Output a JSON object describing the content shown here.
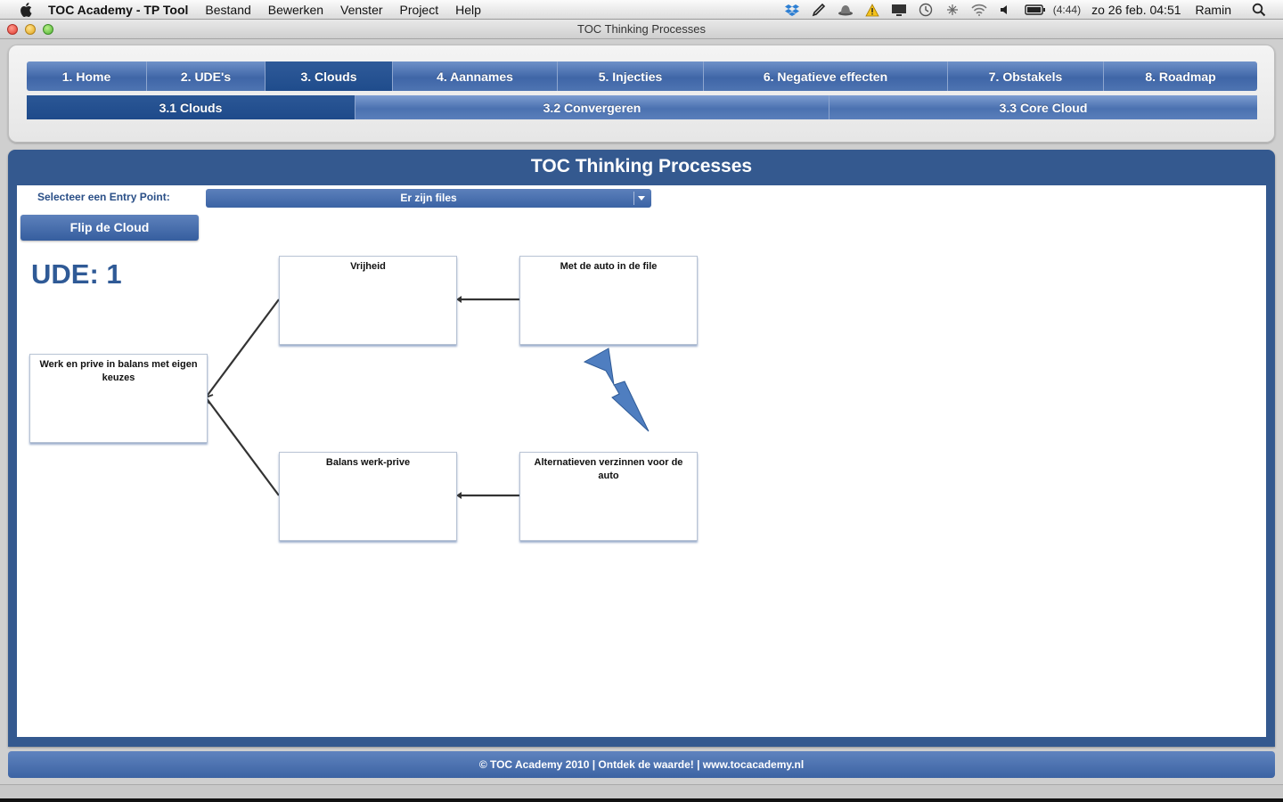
{
  "menubar": {
    "app_name": "TOC Academy - TP Tool",
    "menus": [
      "Bestand",
      "Bewerken",
      "Venster",
      "Project",
      "Help"
    ],
    "battery": "(4:44)",
    "clock": "zo 26 feb.  04:51",
    "user": "Ramin"
  },
  "window": {
    "title": "TOC Thinking Processes"
  },
  "tabs": [
    {
      "label": "1. Home"
    },
    {
      "label": "2. UDE's"
    },
    {
      "label": "3. Clouds"
    },
    {
      "label": "4. Aannames"
    },
    {
      "label": "5. Injecties"
    },
    {
      "label": "6. Negatieve effecten"
    },
    {
      "label": "7. Obstakels"
    },
    {
      "label": "8. Roadmap"
    }
  ],
  "subtabs": [
    {
      "label": "3.1 Clouds"
    },
    {
      "label": "3.2 Convergeren"
    },
    {
      "label": "3.3 Core Cloud"
    }
  ],
  "main": {
    "title": "TOC Thinking Processes",
    "entry_label": "Selecteer een Entry Point:",
    "entry_value": "Er zijn files",
    "flip_button": "Flip de Cloud",
    "ude_label": "UDE: 1"
  },
  "cloud": {
    "goal": "Werk en prive in balans met eigen keuzes",
    "need_top": "Vrijheid",
    "need_bottom": "Balans werk-prive",
    "want_top": "Met de auto in de file",
    "want_bottom": "Alternatieven verzinnen voor de auto"
  },
  "footer": {
    "text": "© TOC Academy 2010   | Ontdek de waarde!  | www.tocacademy.nl"
  }
}
